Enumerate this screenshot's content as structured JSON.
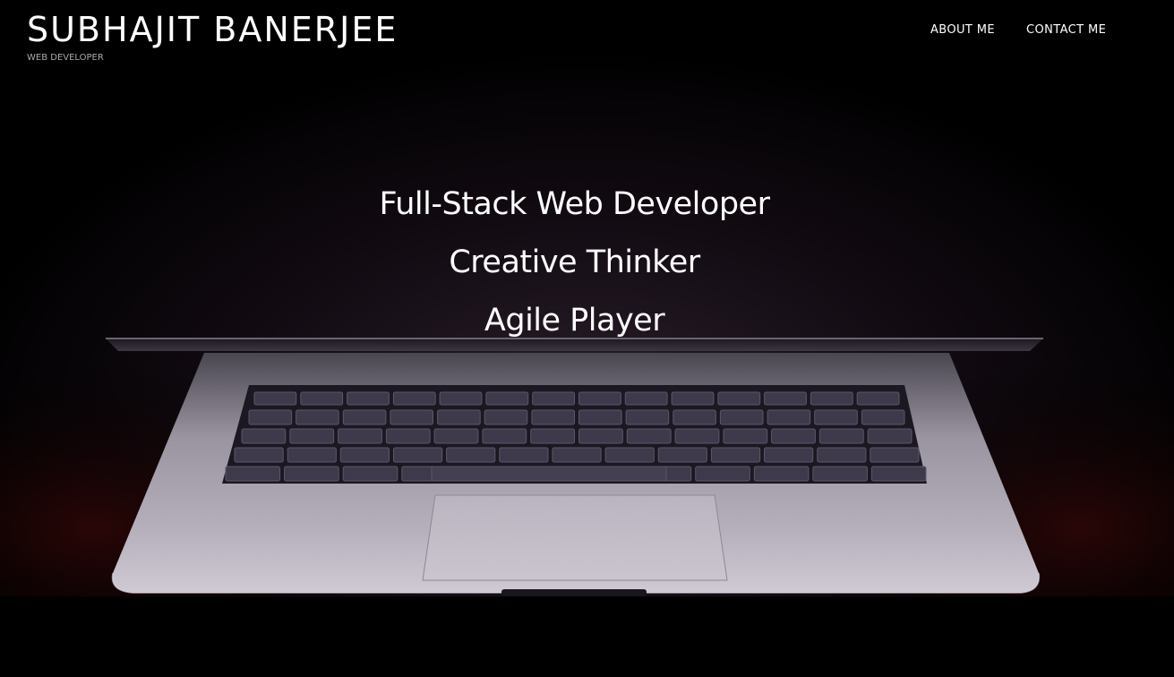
{
  "site": {
    "title": "SUBHAJIT BANERJEE",
    "tagline": "WEB DEVELOPER"
  },
  "nav": {
    "items": [
      {
        "label": "ABOUT ME"
      },
      {
        "label": "CONTACT ME"
      }
    ]
  },
  "hero": {
    "headlines": [
      "Full-Stack Web Developer",
      "Creative Thinker",
      "Agile Player"
    ]
  },
  "colors": {
    "background": "#000000",
    "text": "#ffffff",
    "tagline": "#a9a9a9",
    "laptop_body": "#9d9aa3",
    "keyboard_keys": "#3f3a4b"
  }
}
